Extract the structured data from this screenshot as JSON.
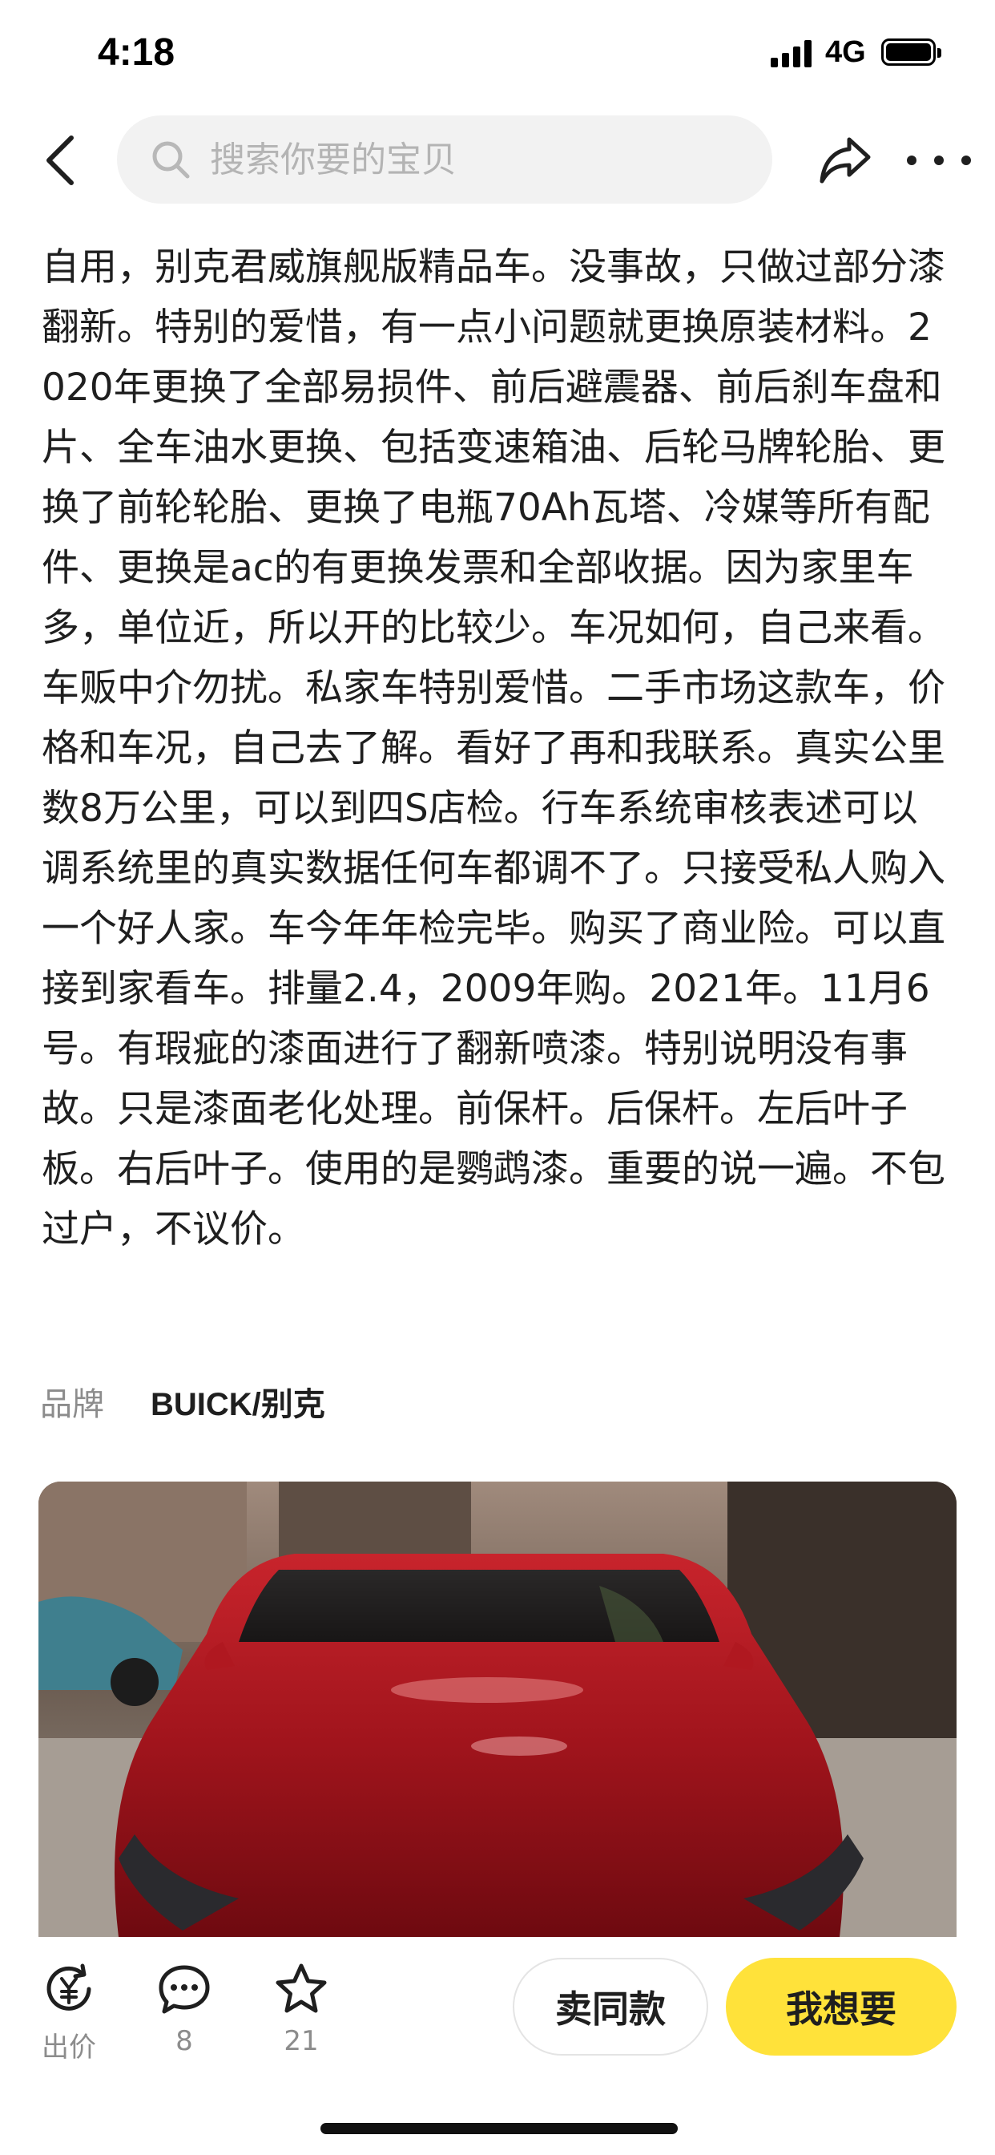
{
  "status_bar": {
    "time": "4:18",
    "network": "4G"
  },
  "header": {
    "search_placeholder": "搜索你要的宝贝"
  },
  "description": "自用，别克君威旗舰版精品车。没事故，只做过部分漆翻新。特别的爱惜，有一点小问题就更换原装材料。2020年更换了全部易损件、前后避震器、前后刹车盘和片、全车油水更换、包括变速箱油、后轮马牌轮胎、更换了前轮轮胎、更换了电瓶70Ah瓦塔、冷媒等所有配件、更换是ac的有更换发票和全部收据。因为家里车多，单位近，所以开的比较少。车况如何，自己来看。车贩中介勿扰。私家车特别爱惜。二手市场这款车，价格和车况，自己去了解。看好了再和我联系。真实公里数8万公里，可以到四S店检。行车系统审核表述可以调系统里的真实数据任何车都调不了。只接受私人购入一个好人家。车今年年检完毕。购买了商业险。可以直接到家看车。排量2.4，2009年购。2021年。11月6号。有瑕疵的漆面进行了翻新喷漆。特别说明没有事故。只是漆面老化处理。前保杆。后保杆。左后叶子板。右后叶子。使用的是鹦鹉漆。重要的说一遍。不包过户，不议价。",
  "brand": {
    "label": "品牌",
    "value": "BUICK/别克"
  },
  "bottom_bar": {
    "offer_label": "出价",
    "comment_count": "8",
    "favorite_count": "21",
    "sell_same_label": "卖同款",
    "want_label": "我想要"
  },
  "colors": {
    "accent_yellow": "#ffe23a",
    "text_primary": "#1f1f1f",
    "text_secondary": "#8c8c8c",
    "search_bg": "#f2f2f2"
  }
}
